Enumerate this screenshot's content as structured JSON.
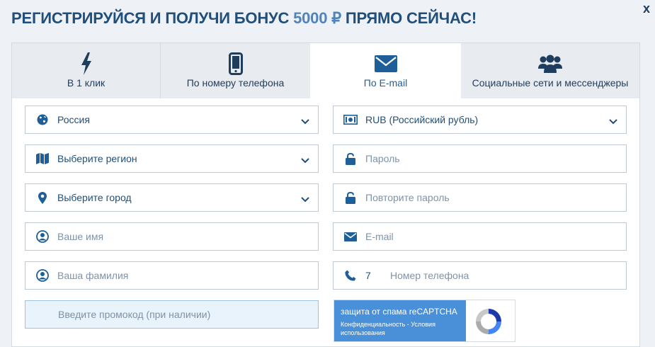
{
  "header": {
    "title_prefix": "РЕГИСТРИРУЙСЯ И ПОЛУЧИ БОНУС ",
    "title_bonus": "5000 ₽",
    "title_suffix": " ПРЯМО СЕЙЧАС!",
    "close_label": "x"
  },
  "tabs": [
    {
      "label": "В 1 клик",
      "icon": "lightning-icon",
      "active": false
    },
    {
      "label": "По номеру телефона",
      "icon": "phone-icon",
      "active": false
    },
    {
      "label": "По E-mail",
      "icon": "envelope-icon",
      "active": true
    },
    {
      "label": "Социальные сети и мессенджеры",
      "icon": "users-icon",
      "active": false
    }
  ],
  "form": {
    "country": {
      "value": "Россия",
      "icon": "globe-icon"
    },
    "region": {
      "value": "Выберите регион",
      "icon": "map-icon"
    },
    "city": {
      "value": "Выберите город",
      "icon": "location-pin-icon"
    },
    "first_name": {
      "placeholder": "Ваше имя",
      "icon": "user-icon"
    },
    "last_name": {
      "placeholder": "Ваша фамилия",
      "icon": "user-icon"
    },
    "promo": {
      "placeholder": "Введите промокод (при наличии)"
    },
    "currency": {
      "value": "RUB (Российский рубль)",
      "icon": "money-icon"
    },
    "password": {
      "placeholder": "Пароль",
      "icon": "lock-icon"
    },
    "password_repeat": {
      "placeholder": "Повторите пароль",
      "icon": "lock-icon"
    },
    "email": {
      "placeholder": "E-mail",
      "icon": "envelope-icon"
    },
    "phone": {
      "code": "7",
      "placeholder": "Номер телефона",
      "icon": "phone-icon"
    }
  },
  "captcha": {
    "title": "защита от спама reCAPTCHA",
    "links": "Конфиденциальность - Условия использования"
  },
  "colors": {
    "brand_dark": "#1f4f7a",
    "brand_accent": "#4f83b9",
    "icon": "#1f5f99",
    "captcha_blue": "#4a90d9"
  }
}
